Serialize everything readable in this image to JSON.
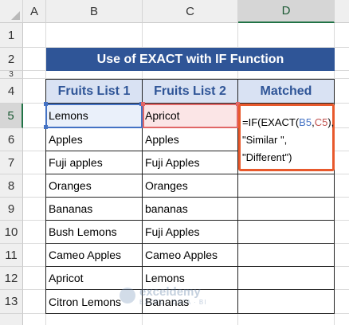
{
  "columns": [
    "A",
    "B",
    "C",
    "D"
  ],
  "rows": [
    "1",
    "2",
    "3",
    "4",
    "5",
    "6",
    "7",
    "8",
    "9",
    "10",
    "11",
    "12",
    "13"
  ],
  "title": "Use of EXACT with IF Function",
  "headers": {
    "fruits1": "Fruits List 1",
    "fruits2": "Fruits List 2",
    "matched": "Matched"
  },
  "table": [
    {
      "list1": "Lemons",
      "list2": "Apricot"
    },
    {
      "list1": "Apples",
      "list2": "Apples"
    },
    {
      "list1": "Fuji apples",
      "list2": "Fuji Apples"
    },
    {
      "list1": "Oranges",
      "list2": "Oranges"
    },
    {
      "list1": "Bananas",
      "list2": "bananas"
    },
    {
      "list1": "Bush Lemons",
      "list2": "Fuji Apples"
    },
    {
      "list1": "Cameo Apples",
      "list2": "Cameo Apples"
    },
    {
      "list1": "Apricot",
      "list2": "Lemons"
    },
    {
      "list1": "Citron Lemons",
      "list2": "Bananas"
    }
  ],
  "formula": {
    "prefix": "=IF(EXACT(",
    "ref1": "B5",
    "comma": ",",
    "ref2": "C5",
    "suffix": "),",
    "line2": "\"Similar \",",
    "line3": "\"Different\")"
  },
  "watermark": {
    "title": "exceldemy",
    "subtitle": "EXCEL · DATA · BI"
  },
  "colors": {
    "title_bg": "#2f5597",
    "header_bg": "#d9e2f3",
    "header_text": "#2f5597",
    "ref_b": "#4472c4",
    "ref_c": "#c0504d",
    "formula_border": "#e8592c",
    "selected_header": "#217346"
  }
}
